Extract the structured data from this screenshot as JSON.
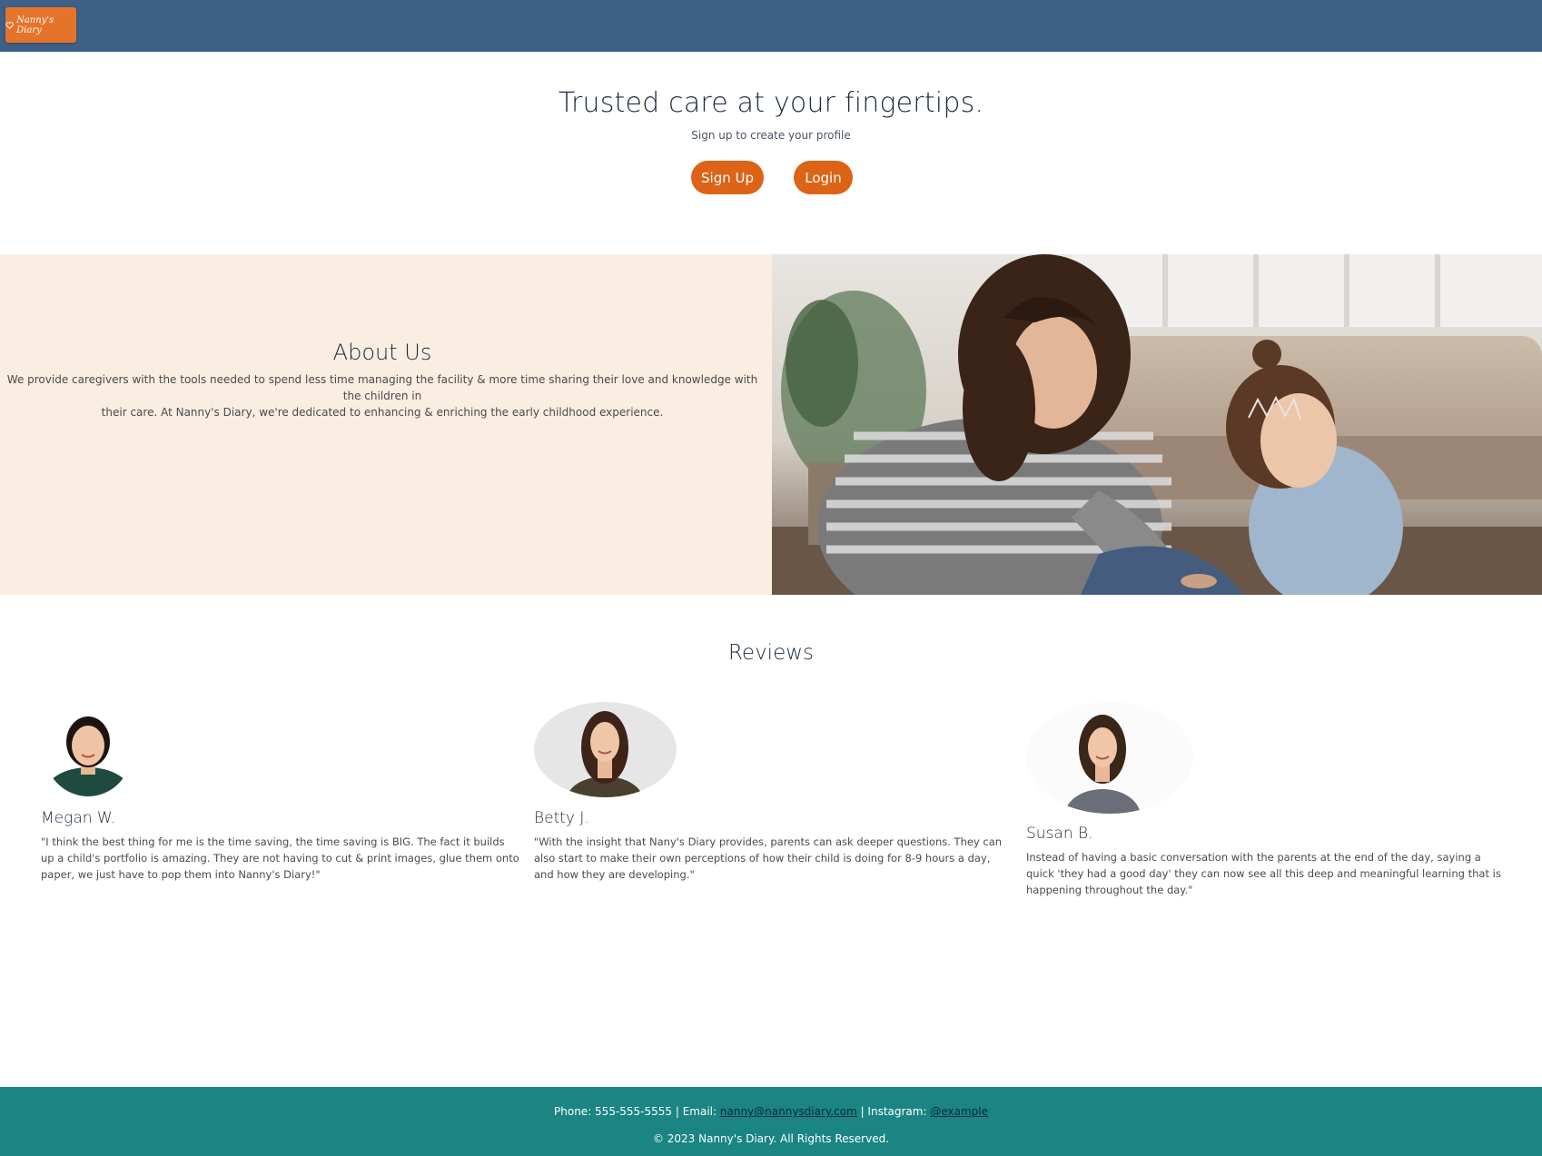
{
  "nav": {
    "brand_label": "Nanny's Diary",
    "brand_icon": "heart-icon"
  },
  "hero": {
    "title": "Trusted care at your fingertips.",
    "subtitle": "Sign up to create your profile",
    "signup_label": "Sign Up",
    "login_label": "Login"
  },
  "about": {
    "title": "About Us",
    "text_line1": "We provide caregivers with the tools needed to spend less time managing the facility & more time sharing their love and knowledge with the children in",
    "text_line2": "their care. At Nanny's Diary, we're dedicated to enhancing & enriching the early childhood experience."
  },
  "reviews": {
    "title": "Reviews",
    "items": [
      {
        "name": "Megan W.",
        "quote": "\"I think the best thing for me is the time saving, the time saving is BIG. The fact it builds up a child's portfolio is amazing. They are not having to cut & print images, glue them onto paper, we just have to pop them into Nanny's Diary!\""
      },
      {
        "name": "Betty J.",
        "quote": "\"With the insight that Nany's Diary provides, parents can ask deeper questions. They can also start to make their own perceptions of how their child is doing for 8-9 hours a day, and how they are developing.\""
      },
      {
        "name": "Susan B.",
        "quote": "Instead of having a basic conversation with the parents at the end of the day, saying a quick 'they had a good day' they can now see all this deep and meaningful learning that is happening throughout the day.\""
      }
    ]
  },
  "footer": {
    "phone_label": "Phone: 555-555-5555 | Email: ",
    "email": "nanny@nannysdiary.com",
    "instagram_label": " | Instagram: ",
    "instagram": "@example",
    "copyright": "© 2023 Nanny's Diary. All Rights Reserved."
  },
  "colors": {
    "navbar": "#3e5f86",
    "accent": "#dd6317",
    "about_bg": "#faede2",
    "footer": "#1a8583"
  }
}
